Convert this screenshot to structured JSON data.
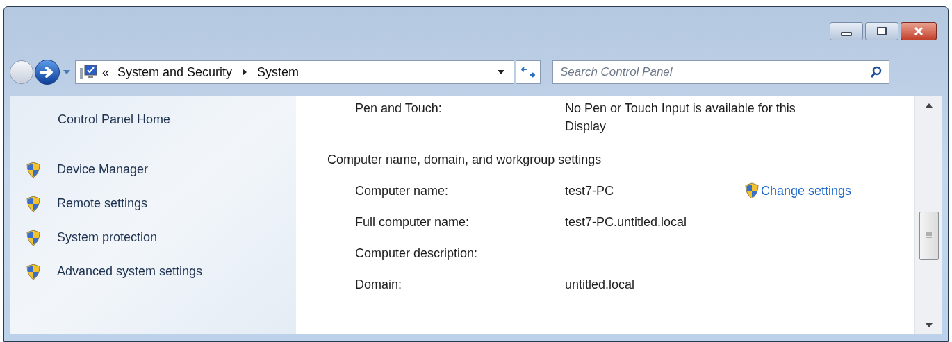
{
  "window": {
    "buttons": [
      {
        "kind": "minimize"
      },
      {
        "kind": "maximize"
      },
      {
        "kind": "close"
      }
    ]
  },
  "address_bar": {
    "overflow": "«",
    "breadcrumbs": [
      "System and Security",
      "System"
    ]
  },
  "search": {
    "placeholder": "Search Control Panel"
  },
  "sidebar": {
    "home": "Control Panel Home",
    "items": [
      {
        "label": "Device Manager"
      },
      {
        "label": "Remote settings"
      },
      {
        "label": "System protection"
      },
      {
        "label": "Advanced system settings"
      }
    ]
  },
  "main": {
    "pen_row": {
      "label": "Pen and Touch:",
      "value": "No Pen or Touch Input is available for this Display"
    },
    "section": {
      "title": "Computer name, domain, and workgroup settings",
      "change_link": "Change settings",
      "rows": [
        {
          "label": "Computer name:",
          "value": "test7-PC"
        },
        {
          "label": "Full computer name:",
          "value": "test7-PC.untitled.local"
        },
        {
          "label": "Computer description:",
          "value": ""
        },
        {
          "label": "Domain:",
          "value": "untitled.local"
        }
      ]
    }
  }
}
